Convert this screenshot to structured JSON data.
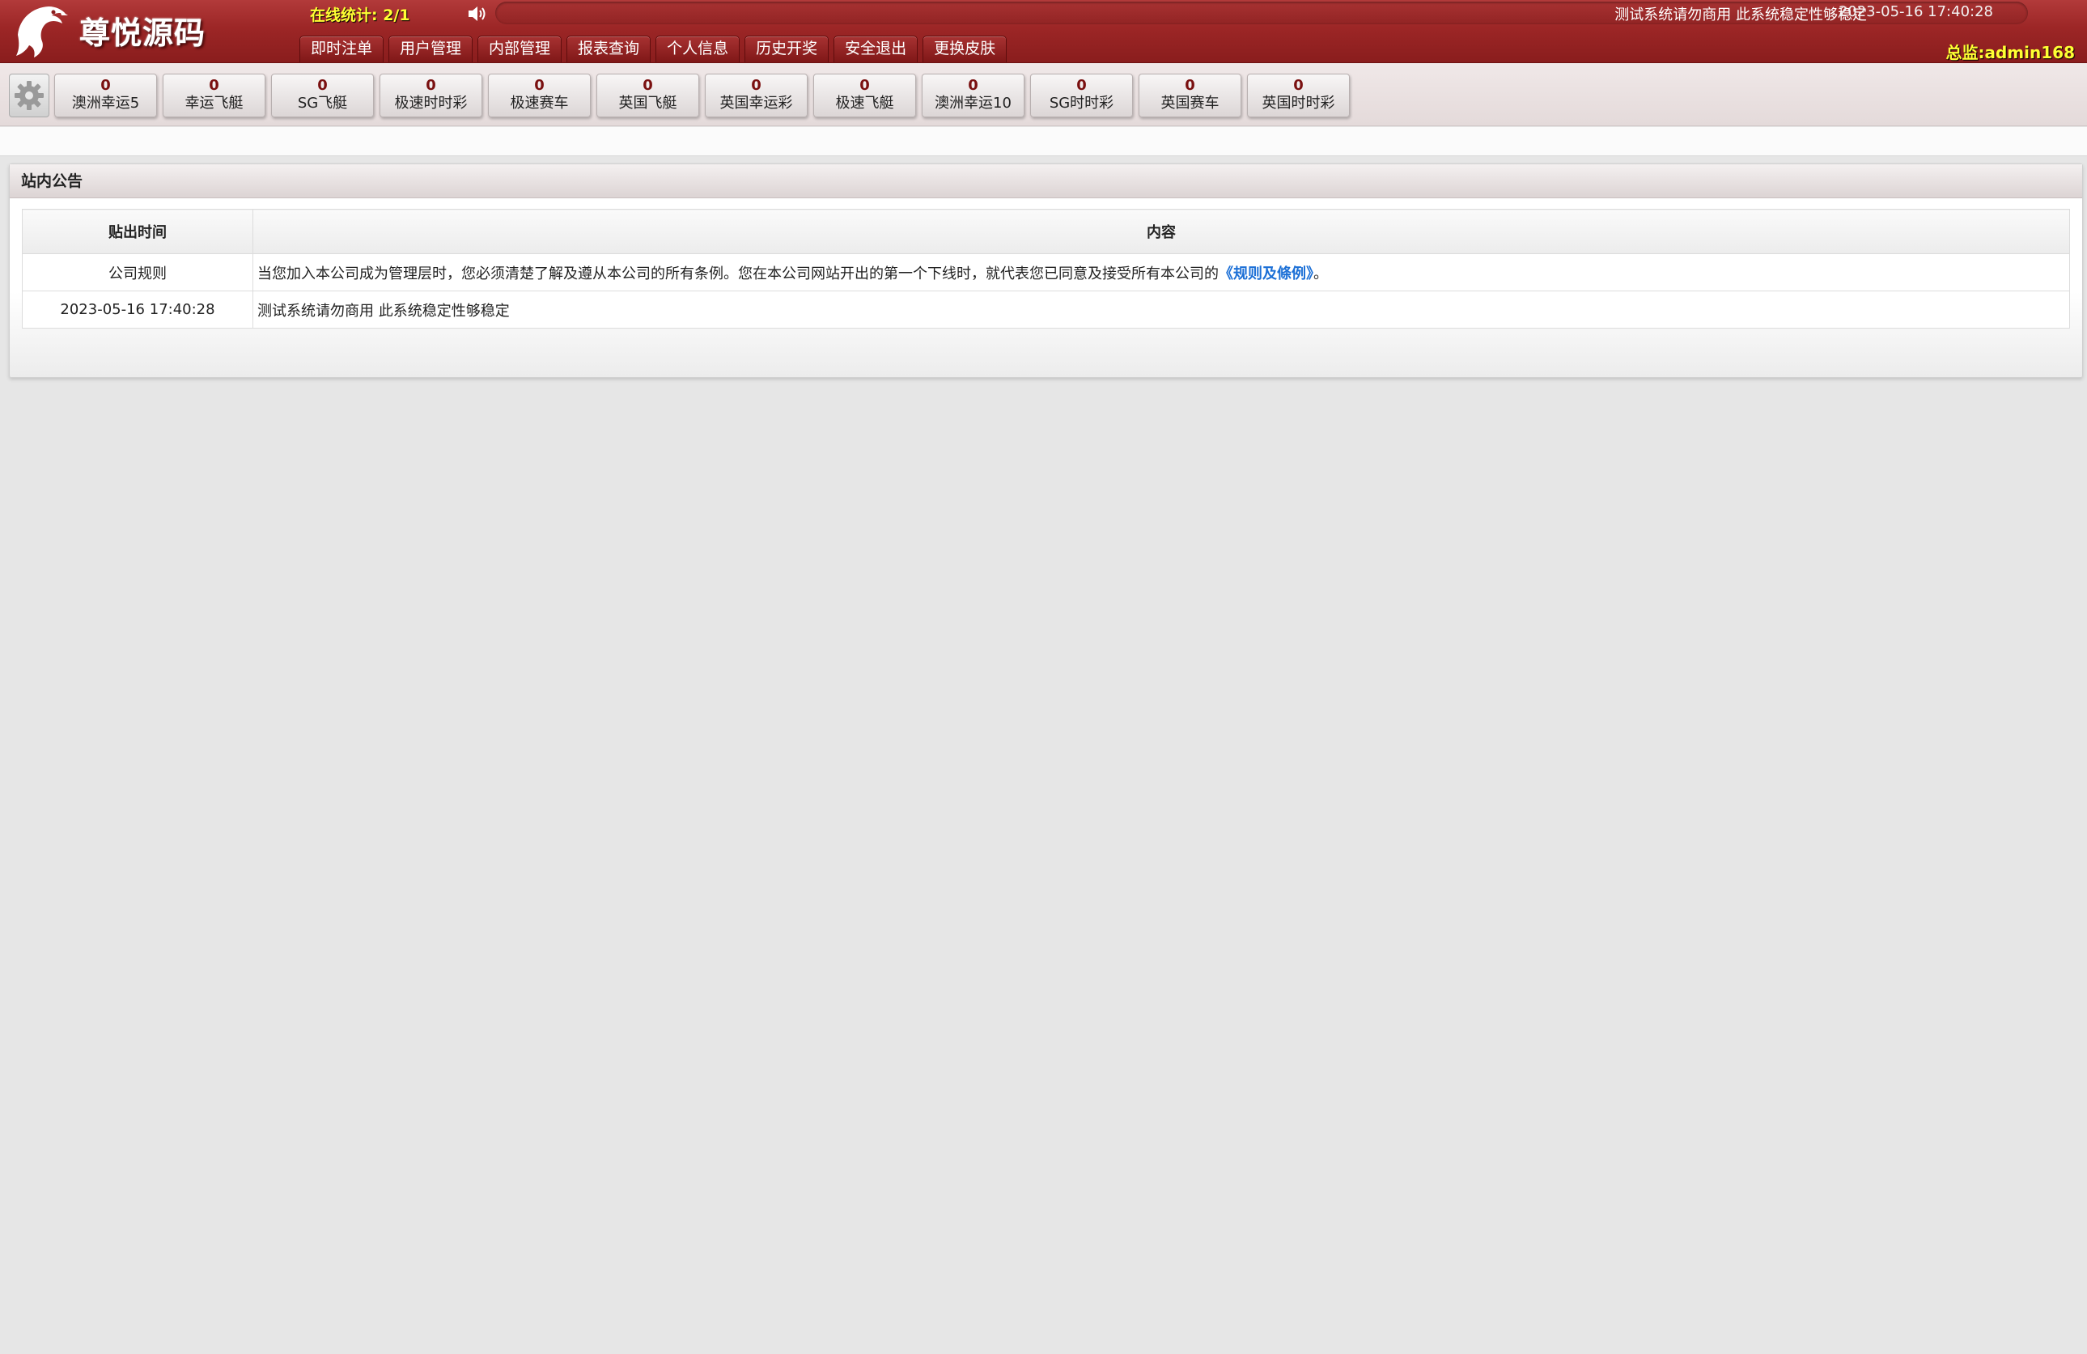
{
  "header": {
    "logo_text": "尊悦源码",
    "online_stat": "在线统计: 2/1",
    "marquee": "测试系统请勿商用 此系统稳定性够稳定",
    "datetime": "2023-05-16 17:40:28",
    "user_label": "总监:admin168",
    "colors": {
      "bar": "#9c2626",
      "highlight": "#ffff33"
    }
  },
  "nav": {
    "items": [
      {
        "label": "即时注单"
      },
      {
        "label": "用户管理"
      },
      {
        "label": "内部管理"
      },
      {
        "label": "报表查询"
      },
      {
        "label": "个人信息"
      },
      {
        "label": "历史开奖"
      },
      {
        "label": "安全退出"
      },
      {
        "label": "更换皮肤"
      }
    ]
  },
  "toolbar": {
    "settings_icon": "gear-icon",
    "lotteries": [
      {
        "count": "0",
        "name": "澳洲幸运5"
      },
      {
        "count": "0",
        "name": "幸运飞艇"
      },
      {
        "count": "0",
        "name": "SG飞艇"
      },
      {
        "count": "0",
        "name": "极速时时彩"
      },
      {
        "count": "0",
        "name": "极速赛车"
      },
      {
        "count": "0",
        "name": "英国飞艇"
      },
      {
        "count": "0",
        "name": "英国幸运彩"
      },
      {
        "count": "0",
        "name": "极速飞艇"
      },
      {
        "count": "0",
        "name": "澳洲幸运10"
      },
      {
        "count": "0",
        "name": "SG时时彩"
      },
      {
        "count": "0",
        "name": "英国赛车"
      },
      {
        "count": "0",
        "name": "英国时时彩"
      }
    ]
  },
  "notice": {
    "title": "站内公告",
    "columns": [
      "贴出时间",
      "内容"
    ],
    "rows": [
      {
        "time": "公司规则",
        "content": "当您加入本公司成为管理层时，您必须清楚了解及遵从本公司的所有条例。您在本公司网站开出的第一个下线时，就代表您已同意及接受所有本公司的",
        "link": "《规则及條例》",
        "suffix": "。"
      },
      {
        "time": "2023-05-16 17:40:28",
        "content": "测试系统请勿商用 此系统稳定性够稳定"
      }
    ]
  }
}
